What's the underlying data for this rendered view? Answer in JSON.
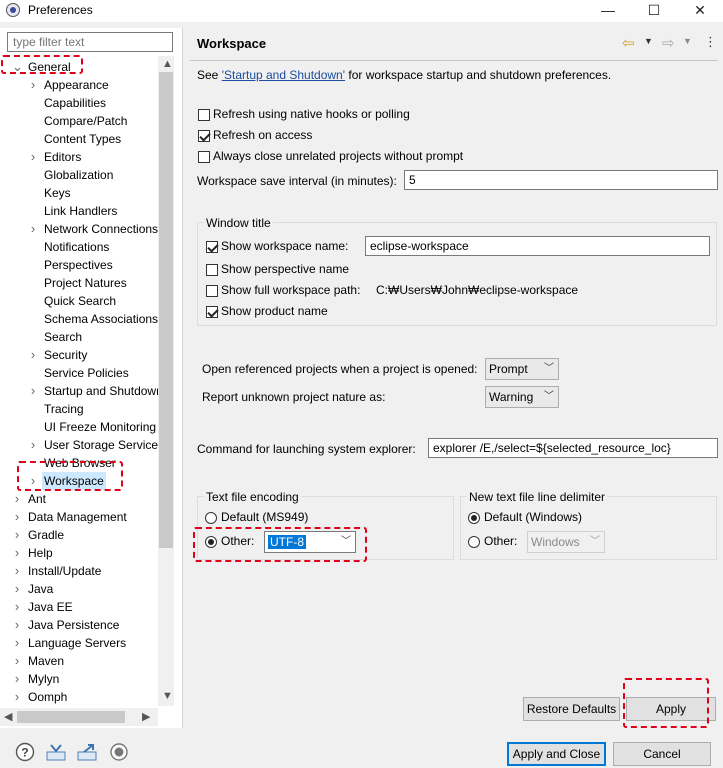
{
  "window": {
    "title": "Preferences",
    "minimize": "—",
    "maximize": "☐",
    "close": "✕"
  },
  "filter": {
    "placeholder": "type filter text"
  },
  "tree": [
    {
      "label": "General",
      "expanded": true,
      "depth": 0
    },
    {
      "label": "Appearance",
      "depth": 1,
      "twisty": true
    },
    {
      "label": "Capabilities",
      "depth": 1
    },
    {
      "label": "Compare/Patch",
      "depth": 1
    },
    {
      "label": "Content Types",
      "depth": 1
    },
    {
      "label": "Editors",
      "depth": 1,
      "twisty": true
    },
    {
      "label": "Globalization",
      "depth": 1
    },
    {
      "label": "Keys",
      "depth": 1
    },
    {
      "label": "Link Handlers",
      "depth": 1
    },
    {
      "label": "Network Connections",
      "depth": 1,
      "twisty": true
    },
    {
      "label": "Notifications",
      "depth": 1
    },
    {
      "label": "Perspectives",
      "depth": 1
    },
    {
      "label": "Project Natures",
      "depth": 1
    },
    {
      "label": "Quick Search",
      "depth": 1
    },
    {
      "label": "Schema Associations",
      "depth": 1
    },
    {
      "label": "Search",
      "depth": 1
    },
    {
      "label": "Security",
      "depth": 1,
      "twisty": true
    },
    {
      "label": "Service Policies",
      "depth": 1
    },
    {
      "label": "Startup and Shutdown",
      "depth": 1,
      "twisty": true
    },
    {
      "label": "Tracing",
      "depth": 1
    },
    {
      "label": "UI Freeze Monitoring",
      "depth": 1
    },
    {
      "label": "User Storage Service",
      "depth": 1,
      "twisty": true
    },
    {
      "label": "Web Browser",
      "depth": 1
    },
    {
      "label": "Workspace",
      "depth": 1,
      "twisty": true,
      "selected": true
    },
    {
      "label": "Ant",
      "depth": 0,
      "twisty": true
    },
    {
      "label": "Data Management",
      "depth": 0,
      "twisty": true
    },
    {
      "label": "Gradle",
      "depth": 0,
      "twisty": true
    },
    {
      "label": "Help",
      "depth": 0,
      "twisty": true
    },
    {
      "label": "Install/Update",
      "depth": 0,
      "twisty": true
    },
    {
      "label": "Java",
      "depth": 0,
      "twisty": true
    },
    {
      "label": "Java EE",
      "depth": 0,
      "twisty": true
    },
    {
      "label": "Java Persistence",
      "depth": 0,
      "twisty": true
    },
    {
      "label": "Language Servers",
      "depth": 0,
      "twisty": true
    },
    {
      "label": "Maven",
      "depth": 0,
      "twisty": true
    },
    {
      "label": "Mylyn",
      "depth": 0,
      "twisty": true
    },
    {
      "label": "Oomph",
      "depth": 0,
      "twisty": true
    }
  ],
  "page": {
    "title": "Workspace",
    "see_prefix": "See ",
    "see_link": "'Startup and Shutdown'",
    "see_suffix": " for workspace startup and shutdown preferences.",
    "refresh_native": "Refresh using native hooks or polling",
    "refresh_access": "Refresh on access",
    "close_unrelated": "Always close unrelated projects without prompt",
    "save_interval_label": "Workspace save interval (in minutes):",
    "save_interval_value": "5",
    "window_title_group": "Window title",
    "show_ws_name": "Show workspace name:",
    "ws_name_value": "eclipse-workspace",
    "show_perspective": "Show perspective name",
    "show_full_path": "Show full workspace path:",
    "full_path_value": "C:₩Users₩John₩eclipse-workspace",
    "show_product": "Show product name",
    "open_ref_label": "Open referenced projects when a project is opened:",
    "open_ref_value": "Prompt",
    "report_nature_label": "Report unknown project nature as:",
    "report_nature_value": "Warning",
    "cmd_label": "Command for launching system explorer:",
    "cmd_value": "explorer /E,/select=${selected_resource_loc}",
    "encoding_group": "Text file encoding",
    "enc_default": "Default (MS949)",
    "enc_other": "Other:",
    "enc_other_value": "UTF-8",
    "delim_group": "New text file line delimiter",
    "delim_default": "Default (Windows)",
    "delim_other": "Other:",
    "delim_other_value": "Windows",
    "restore_defaults": "Restore Defaults",
    "apply": "Apply"
  },
  "footer": {
    "apply_close": "Apply and Close",
    "cancel": "Cancel"
  },
  "colors": {
    "highlight": "#e0001a",
    "selection": "#cce8ff",
    "link": "#1a4d9e"
  }
}
